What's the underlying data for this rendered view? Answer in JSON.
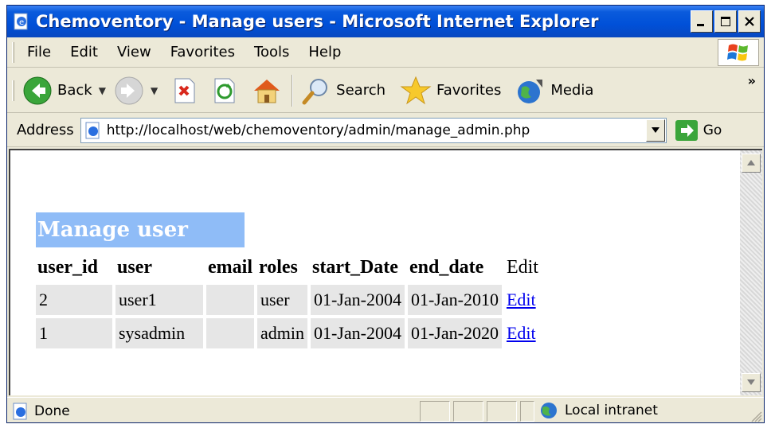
{
  "window": {
    "title": "Chemoventory - Manage users - Microsoft Internet Explorer"
  },
  "menu": [
    "File",
    "Edit",
    "View",
    "Favorites",
    "Tools",
    "Help"
  ],
  "toolbar": {
    "back": "Back",
    "search": "Search",
    "favorites": "Favorites",
    "media": "Media"
  },
  "address": {
    "label": "Address",
    "url": "http://localhost/web/chemoventory/admin/manage_admin.php",
    "go": "Go"
  },
  "page": {
    "heading": "Manage user",
    "columns": [
      "user_id",
      "user",
      "email",
      "roles",
      "start_Date",
      "end_date",
      "Edit"
    ],
    "rows": [
      {
        "user_id": "2",
        "user": "user1",
        "email": "",
        "roles": "user",
        "start_date": "01-Jan-2004",
        "end_date": "01-Jan-2010",
        "edit": "Edit"
      },
      {
        "user_id": "1",
        "user": "sysadmin",
        "email": "",
        "roles": "admin",
        "start_date": "01-Jan-2004",
        "end_date": "01-Jan-2020",
        "edit": "Edit"
      }
    ]
  },
  "status": {
    "text": "Done",
    "zone": "Local intranet"
  },
  "colors": {
    "titlebar": "#0050d8",
    "heading_bg": "#8fbcf7",
    "cell_bg": "#e6e6e6",
    "link": "#0000ee"
  }
}
